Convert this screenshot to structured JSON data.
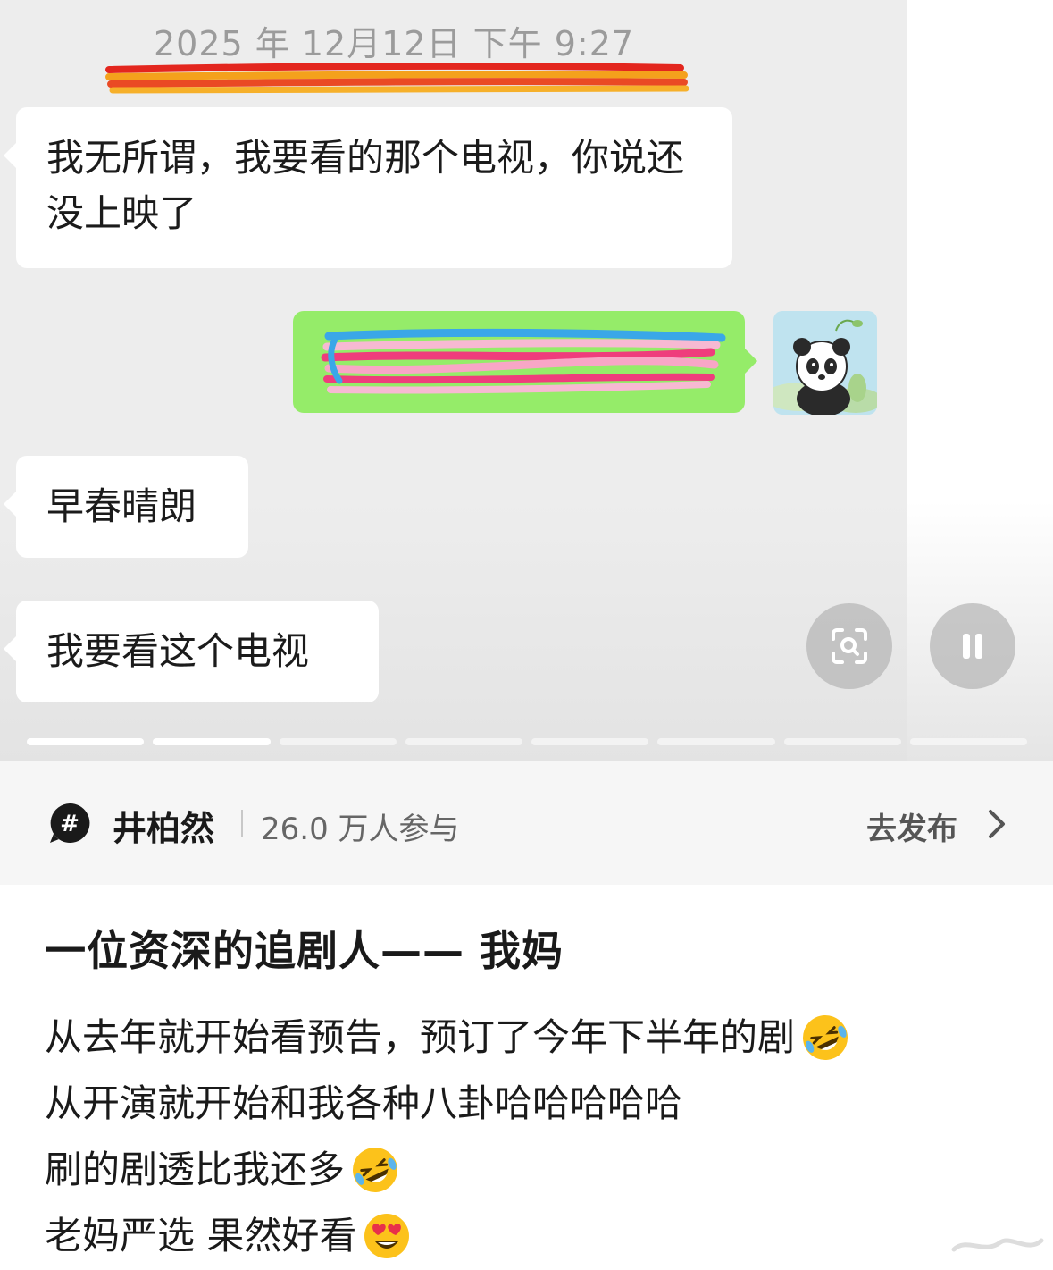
{
  "chat": {
    "timestamp": "2025 年 12月12日 下午 9:27",
    "messages": [
      {
        "side": "left",
        "text": "我无所谓，我要看的那个电视，你说还没上映了"
      },
      {
        "side": "right",
        "text": ""
      },
      {
        "side": "left",
        "text": "早春晴朗"
      },
      {
        "side": "left",
        "text": "我要看这个电视"
      }
    ],
    "avatar_icon": "panda-avatar-icon",
    "scan_icon": "scan-search-icon",
    "pause_icon": "pause-icon",
    "progress": {
      "total": 8,
      "current": 2
    },
    "colors": {
      "background": "#ededed",
      "bubble_left": "#ffffff",
      "bubble_right": "#95ec69"
    }
  },
  "topic": {
    "icon": "hashtag-icon",
    "name": "井柏然",
    "count": "26.0 万人参与",
    "action": "去发布",
    "chevron_icon": "chevron-right-icon"
  },
  "post": {
    "title": "一位资深的追剧人—— 我妈",
    "lines": [
      {
        "text": "从去年就开始看预告，预订了今年下半年的剧",
        "emoji": "rofl-emoji-icon"
      },
      {
        "text": "从开演就开始和我各种八卦哈哈哈哈哈",
        "emoji": ""
      },
      {
        "text": "刷的剧透比我还多",
        "emoji": "rofl-emoji-icon"
      },
      {
        "text": "老妈严选 果然好看",
        "emoji": "heart-eyes-emoji-icon"
      }
    ]
  }
}
